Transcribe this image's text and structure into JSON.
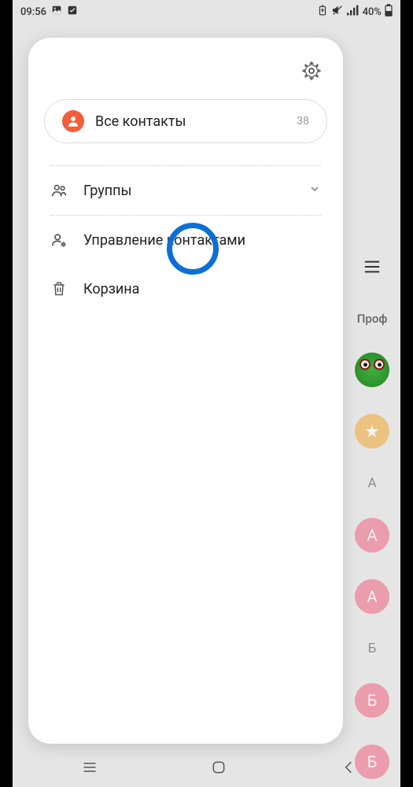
{
  "status": {
    "time": "09:56",
    "battery": "40%"
  },
  "drawer": {
    "allContacts": {
      "label": "Все контакты",
      "count": "38"
    },
    "groups": "Группы",
    "manage": "Управление контактами",
    "trash": "Корзина"
  },
  "main": {
    "section": "Проф",
    "letters": [
      "А",
      "Б"
    ],
    "initials": {
      "a1": "А",
      "a2": "А",
      "b1": "Б",
      "b2": "Б"
    }
  }
}
